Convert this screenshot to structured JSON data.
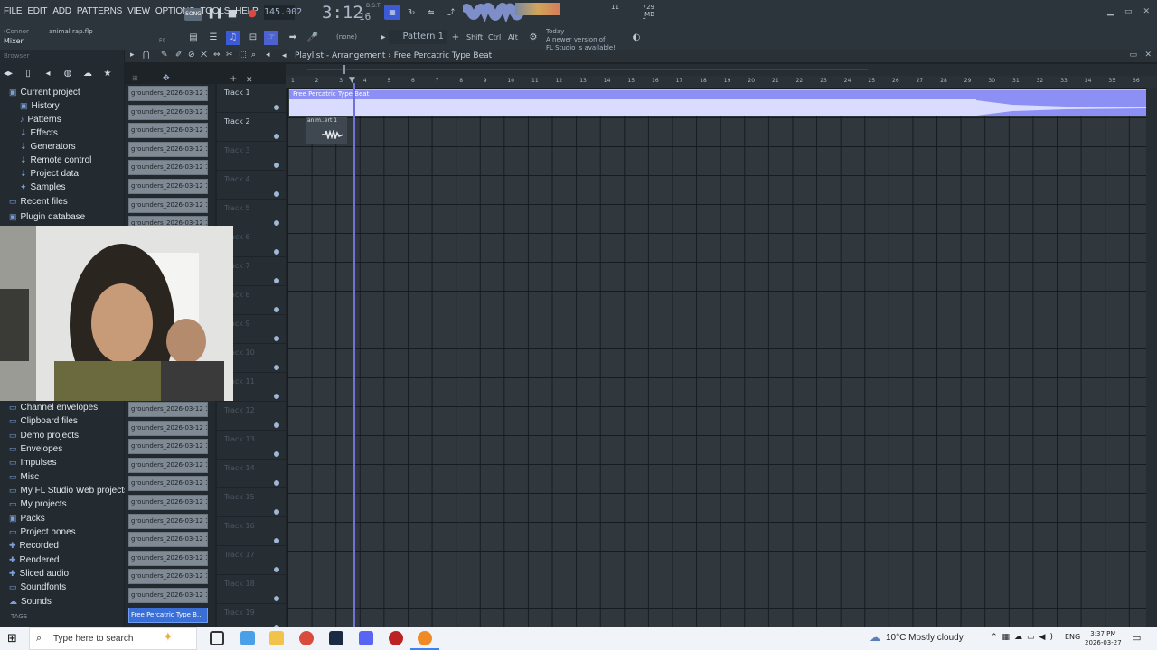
{
  "menu": [
    "FILE",
    "EDIT",
    "ADD",
    "PATTERNS",
    "VIEW",
    "OPTIONS",
    "TOOLS",
    "HELP"
  ],
  "song_label": "SONG",
  "bpm": "145.002",
  "time_main": "3:12",
  "time_sub": "16",
  "time_sig": "B:S:T",
  "mem": "729 MB",
  "mem_sub": "1",
  "cpu": "11",
  "hint_left": "(Connor",
  "project_file": "animal rap.flp",
  "mixer_label": "Mixer",
  "f9": "F9",
  "pattern_none": "(none)",
  "pattern_selected": "Pattern 1",
  "keys": [
    "Shift",
    "Ctrl",
    "Alt"
  ],
  "news_line1": "Today",
  "news_line2": "A newer version of",
  "news_line3": "FL Studio is available!",
  "browser": {
    "title": "Browser",
    "items": [
      {
        "label": "Current project",
        "icon": "▣",
        "sub": false
      },
      {
        "label": "History",
        "icon": "▣",
        "sub": true
      },
      {
        "label": "Patterns",
        "icon": "♪",
        "sub": true
      },
      {
        "label": "Effects",
        "icon": "⇣",
        "sub": true
      },
      {
        "label": "Generators",
        "icon": "⇣",
        "sub": true
      },
      {
        "label": "Remote control",
        "icon": "⇣",
        "sub": true
      },
      {
        "label": "Project data",
        "icon": "⇣",
        "sub": true
      },
      {
        "label": "Samples",
        "icon": "✦",
        "sub": true
      },
      {
        "label": "Recent files",
        "icon": "▭",
        "sub": false
      },
      {
        "label": "Plugin database",
        "icon": "▣",
        "sub": false
      }
    ],
    "items_lower": [
      {
        "label": "Channel envelopes",
        "icon": "▭"
      },
      {
        "label": "Clipboard files",
        "icon": "▭"
      },
      {
        "label": "Demo projects",
        "icon": "▭"
      },
      {
        "label": "Envelopes",
        "icon": "▭"
      },
      {
        "label": "Impulses",
        "icon": "▭"
      },
      {
        "label": "Misc",
        "icon": "▭"
      },
      {
        "label": "My FL Studio Web projects",
        "icon": "▭"
      },
      {
        "label": "My projects",
        "icon": "▭"
      },
      {
        "label": "Packs",
        "icon": "▣"
      },
      {
        "label": "Project bones",
        "icon": "▭"
      },
      {
        "label": "Recorded",
        "icon": "✚"
      },
      {
        "label": "Rendered",
        "icon": "✚"
      },
      {
        "label": "Sliced audio",
        "icon": "✚"
      },
      {
        "label": "Soundfonts",
        "icon": "▭"
      },
      {
        "label": "Sounds",
        "icon": "☁"
      }
    ],
    "tags": "TAGS"
  },
  "clips_top": [
    "grounders_2026-03-12 1..",
    "grounders_2026-03-12 1..",
    "grounders_2026-03-12 1..",
    "grounders_2026-03-12 1..",
    "grounders_2026-03-12 1..",
    "grounders_2026-03-12 1..",
    "grounders_2026-03-12 1..",
    "grounders_2026-03-12 1.."
  ],
  "clips_bottom": [
    "grounders_2026-03-12 1..",
    "grounders_2026-03-12 1..",
    "grounders_2026-03-12 1..",
    "grounders_2026-03-12 1..",
    "grounders_2026-03-12 1..",
    "grounders_2026-03-12 1..",
    "grounders_2026-03-12 1..",
    "grounders_2026-03-12 1..",
    "grounders_2026-03-12 1..",
    "grounders_2026-03-12 1..",
    "grounders_2026-03-12 1.."
  ],
  "clip_selected": "Free Percatric Type B..",
  "playlist": {
    "p1": "Playlist",
    "sep": "-",
    "p2": "Arrangement",
    "arrow": "›",
    "p3": "Free Percatric Type Beat"
  },
  "tracks": [
    "Track 1",
    "Track 2",
    "Track 3",
    "Track 4",
    "Track 5",
    "Track 6",
    "Track 7",
    "Track 8",
    "Track 9",
    "Track 10",
    "Track 11",
    "Track 12",
    "Track 13",
    "Track 14",
    "Track 15",
    "Track 16",
    "Track 17",
    "Track 18",
    "Track 19"
  ],
  "ruler": [
    "1",
    "2",
    "3",
    "4",
    "5",
    "6",
    "7",
    "8",
    "9",
    "10",
    "11",
    "12",
    "13",
    "14",
    "15",
    "16",
    "17",
    "18",
    "19",
    "20",
    "21",
    "22",
    "23",
    "24",
    "25",
    "26",
    "27",
    "28",
    "29",
    "30",
    "31",
    "32",
    "33",
    "34",
    "35",
    "36"
  ],
  "clip_beat": "Free Percatric Type Beat",
  "clip_anim": "anim..ert 1",
  "taskbar": {
    "search": "Type here to search",
    "weather": "10°C  Mostly cloudy",
    "lang": "ENG",
    "time": "3:37 PM",
    "date": "2026-03-27"
  }
}
